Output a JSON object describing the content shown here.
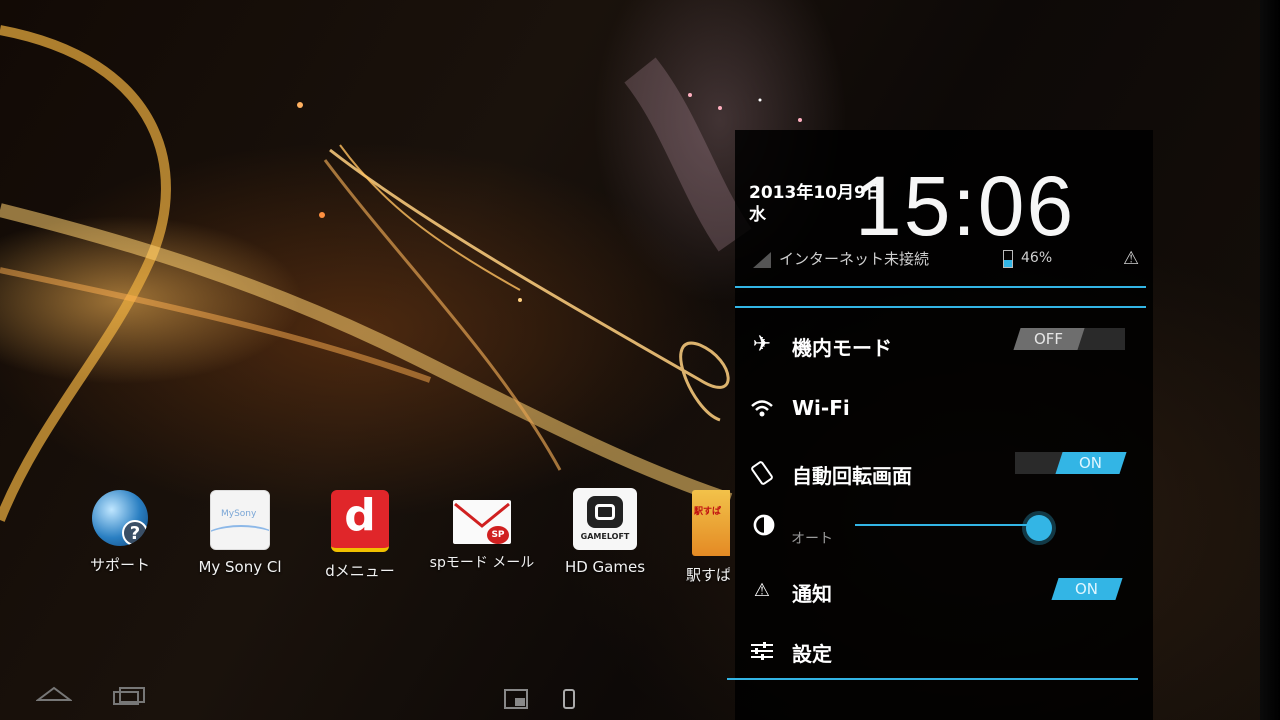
{
  "apps": [
    {
      "label": "サポート",
      "tile": "globe-help",
      "tile_text": ""
    },
    {
      "label": "My Sony Cl",
      "tile": "mysony",
      "tile_text": "MySony"
    },
    {
      "label": "dメニュー",
      "tile": "dmenu",
      "tile_text": "d"
    },
    {
      "label": "spモード メール",
      "tile": "spmail",
      "tile_text": "SP"
    },
    {
      "label": "HD Games",
      "tile": "gameloft",
      "tile_text": "GAMELOFT"
    },
    {
      "label": "駅すぱ",
      "tile": "ekispert",
      "tile_text": "駅すぱ"
    }
  ],
  "panel": {
    "date_line1": "2013年10月9日",
    "date_line2": "水",
    "time": "15:06",
    "network_status": "インターネット未接続",
    "battery": "46%",
    "battery_level_percent": 46,
    "toggles": {
      "airplane": {
        "label": "機内モード",
        "state": "OFF"
      },
      "wifi": {
        "label": "Wi-Fi"
      },
      "auto_rotate": {
        "label": "自動回転画面",
        "state": "ON"
      },
      "brightness": {
        "auto_label": "オート",
        "level_percent": 95
      },
      "notifications": {
        "label": "通知",
        "state": "ON"
      },
      "settings": {
        "label": "設定"
      }
    }
  },
  "colors": {
    "accent": "#33b5e5",
    "panel_bg": "#000000",
    "toggle_off": "#6e6e6e"
  }
}
